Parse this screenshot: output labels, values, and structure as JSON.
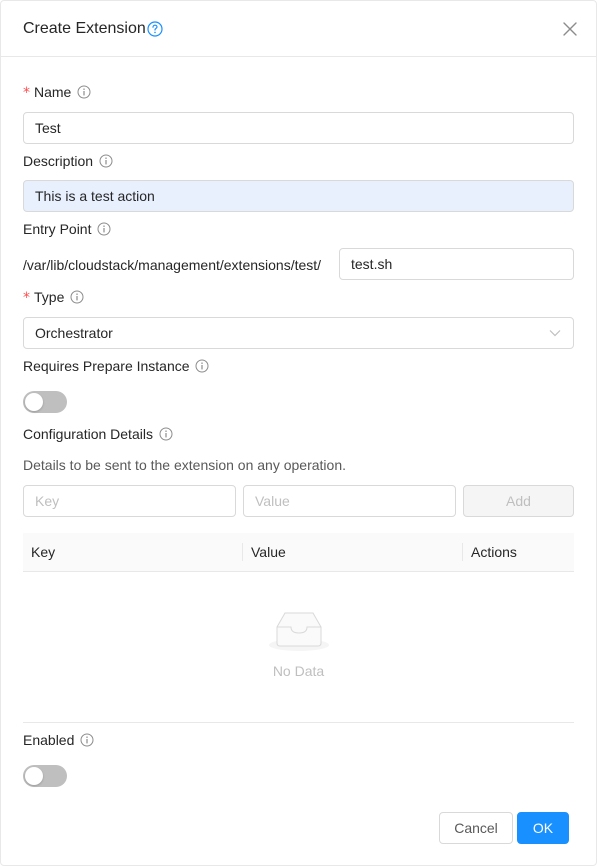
{
  "dialog": {
    "title": "Create Extension"
  },
  "form": {
    "name": {
      "label": "Name",
      "required": "*",
      "value": "Test"
    },
    "description": {
      "label": "Description",
      "value": "This is a test action"
    },
    "entry_point": {
      "label": "Entry Point",
      "prefix": "/var/lib/cloudstack/management/extensions/test/",
      "value": "test.sh"
    },
    "type": {
      "label": "Type",
      "required": "*",
      "value": "Orchestrator"
    },
    "requires_prepare": {
      "label": "Requires Prepare Instance",
      "enabled": false
    },
    "config": {
      "label": "Configuration Details",
      "hint": "Details to be sent to the extension on any operation.",
      "key_placeholder": "Key",
      "value_placeholder": "Value",
      "add_label": "Add",
      "columns": [
        "Key",
        "Value",
        "Actions"
      ],
      "rows": [],
      "empty_text": "No Data"
    },
    "enabled": {
      "label": "Enabled",
      "enabled": false
    }
  },
  "footer": {
    "cancel_label": "Cancel",
    "ok_label": "OK"
  },
  "colors": {
    "primary": "#1890ff",
    "required": "#ff4d4f",
    "toggle_off": "#bfbfbf",
    "focused_input_bg": "#e8f0fe"
  }
}
